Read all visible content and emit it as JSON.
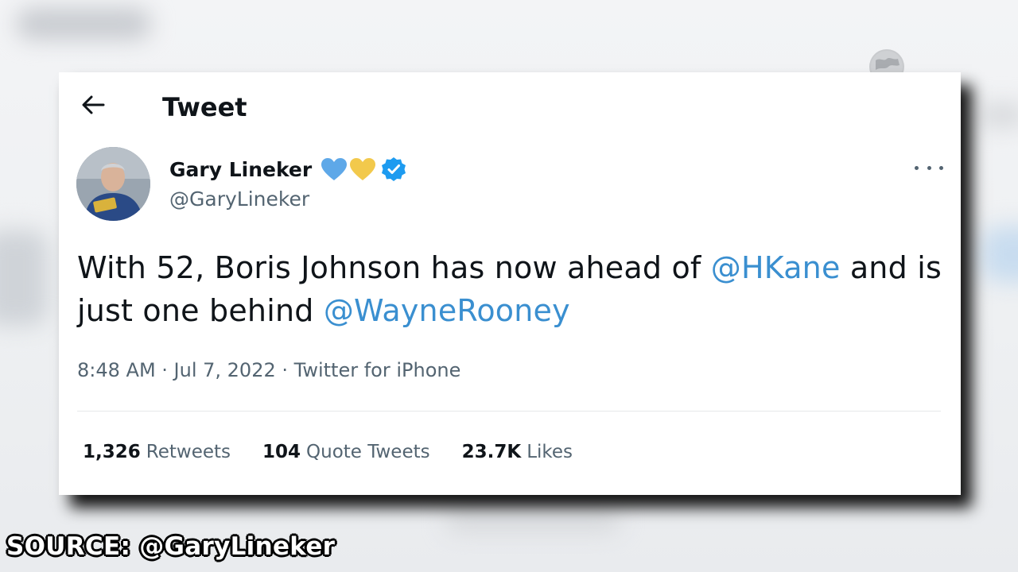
{
  "header": {
    "title": "Tweet",
    "back_icon": "arrow-left-icon"
  },
  "author": {
    "display_name": "Gary Lineker",
    "handle": "@GaryLineker",
    "badges": [
      "blue-heart-icon",
      "yellow-heart-icon",
      "verified-badge-icon"
    ],
    "heart_colors": [
      "#5ea8e8",
      "#f2c94c"
    ],
    "verified_color": "#1d9bf0"
  },
  "more_icon": "more-dots-icon",
  "tweet": {
    "text_part1": "With 52, Boris Johnson has now ahead of ",
    "mention1": "@HKane",
    "text_part2": " and is just one behind ",
    "mention2": "@WayneRooney",
    "mention_color": "#3a8fd0"
  },
  "meta": {
    "time": "8:48 AM",
    "separator": " · ",
    "date": "Jul 7, 2022",
    "source": "Twitter for iPhone"
  },
  "stats": {
    "retweets": {
      "count": "1,326",
      "label": "Retweets"
    },
    "quotes": {
      "count": "104",
      "label": "Quote Tweets"
    },
    "likes": {
      "count": "23.7K",
      "label": "Likes"
    }
  },
  "overlay": {
    "source_caption": "SOURCE: @GaryLineker",
    "globe_icon": "globe-icon"
  }
}
